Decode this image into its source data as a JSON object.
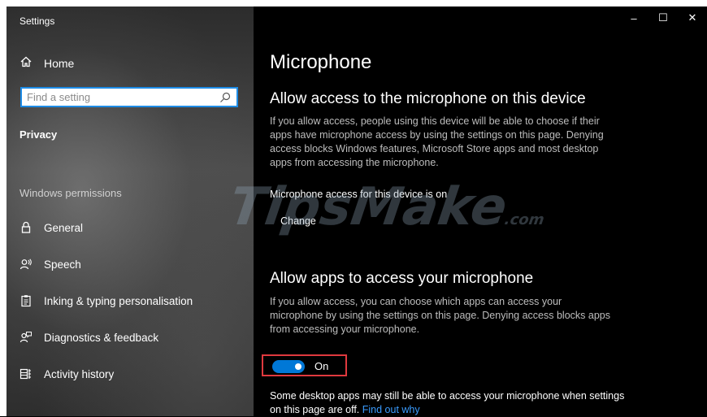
{
  "window": {
    "title": "Settings",
    "controls": {
      "minimize": "–",
      "maximize": "☐",
      "close": "✕"
    }
  },
  "sidebar": {
    "home_label": "Home",
    "search": {
      "placeholder": "Find a setting",
      "value": ""
    },
    "section_label": "Privacy",
    "group_label": "Windows permissions",
    "items": [
      {
        "label": "General",
        "icon": "lock-icon"
      },
      {
        "label": "Speech",
        "icon": "speech-icon"
      },
      {
        "label": "Inking & typing personalisation",
        "icon": "clipboard-icon"
      },
      {
        "label": "Diagnostics & feedback",
        "icon": "feedback-icon"
      },
      {
        "label": "Activity history",
        "icon": "activity-history-icon"
      }
    ]
  },
  "main": {
    "page_title": "Microphone",
    "device_section": {
      "heading": "Allow access to the microphone on this device",
      "description": "If you allow access, people using this device will be able to choose if their apps have microphone access by using the settings on this page. Denying access blocks Windows features, Microsoft Store apps and most desktop apps from accessing the microphone.",
      "status": "Microphone access for this device is on",
      "change_label": "Change"
    },
    "apps_section": {
      "heading": "Allow apps to access your microphone",
      "description": "If you allow access, you can choose which apps can access your microphone by using the settings on this page. Denying access blocks apps from accessing your microphone.",
      "toggle_state": "On",
      "toggle_color": "#0078d7",
      "highlight_color": "#e0393e"
    },
    "note": {
      "text": "Some desktop apps may still be able to access your microphone when settings on this page are off.",
      "link": "Find out why",
      "link_color": "#3a9cff"
    }
  },
  "watermark": {
    "text": "TipsMake",
    "suffix": ".com"
  }
}
